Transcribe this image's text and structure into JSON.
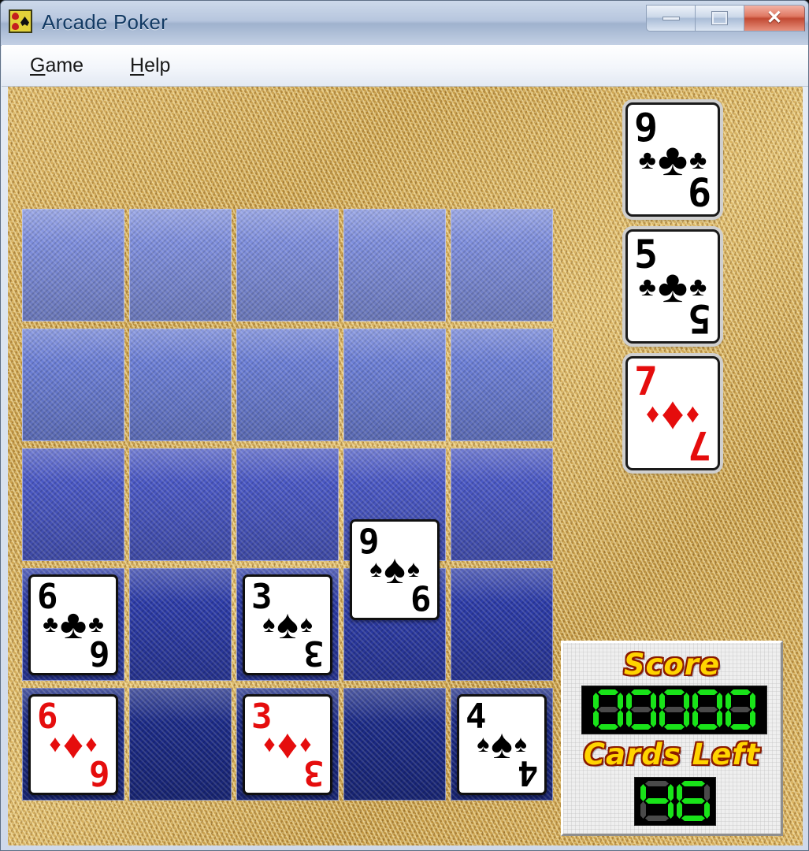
{
  "window": {
    "title": "Arcade Poker",
    "icon": "playing-cards-icon",
    "controls": {
      "minimize": "–",
      "maximize": "□",
      "close": "✕"
    }
  },
  "menubar": {
    "items": [
      {
        "label": "Game",
        "mnemonic": "G"
      },
      {
        "label": "Help",
        "mnemonic": "H"
      }
    ]
  },
  "theme": {
    "felt_color": "#c9a24e",
    "card_back_light": "#7e8edd",
    "card_back_dark": "#1b2a87",
    "lcd_on": "#19e319",
    "lcd_off": "#4a4a4a",
    "label_fill": "#ffd400",
    "label_outline": "#8a1a00",
    "red_suit": "#e50d0d",
    "black_suit": "#000000"
  },
  "scorepanel": {
    "score_label": "Score",
    "score_value": "00000",
    "score_digits": 5,
    "cards_left_label": "Cards Left",
    "cards_left_value": "46",
    "cards_left_digits": 2
  },
  "waiting_cards": [
    {
      "rank": "9",
      "suit": "clubs",
      "suit_glyph": "♣",
      "color": "black"
    },
    {
      "rank": "5",
      "suit": "clubs",
      "suit_glyph": "♣",
      "color": "black"
    },
    {
      "rank": "7",
      "suit": "diamonds",
      "suit_glyph": "♦",
      "color": "red"
    }
  ],
  "grid": {
    "rows": 5,
    "cols": 5,
    "cells": [
      {
        "row": 1,
        "col": 1,
        "state": "face-down",
        "tone": 1
      },
      {
        "row": 1,
        "col": 2,
        "state": "face-down",
        "tone": 1
      },
      {
        "row": 1,
        "col": 3,
        "state": "face-down",
        "tone": 1
      },
      {
        "row": 1,
        "col": 4,
        "state": "face-down",
        "tone": 1
      },
      {
        "row": 1,
        "col": 5,
        "state": "face-down",
        "tone": 1
      },
      {
        "row": 2,
        "col": 1,
        "state": "face-down",
        "tone": 2
      },
      {
        "row": 2,
        "col": 2,
        "state": "face-down",
        "tone": 2
      },
      {
        "row": 2,
        "col": 3,
        "state": "face-down",
        "tone": 2
      },
      {
        "row": 2,
        "col": 4,
        "state": "face-down",
        "tone": 2
      },
      {
        "row": 2,
        "col": 5,
        "state": "face-down",
        "tone": 2
      },
      {
        "row": 3,
        "col": 1,
        "state": "face-down",
        "tone": 3
      },
      {
        "row": 3,
        "col": 2,
        "state": "face-down",
        "tone": 3
      },
      {
        "row": 3,
        "col": 3,
        "state": "face-down",
        "tone": 3
      },
      {
        "row": 3,
        "col": 4,
        "state": "face-down",
        "tone": 3
      },
      {
        "row": 3,
        "col": 5,
        "state": "face-down",
        "tone": 3
      },
      {
        "row": 4,
        "col": 1,
        "state": "face-up",
        "tone": 4,
        "rank": "6",
        "suit": "clubs",
        "suit_glyph": "♣",
        "color": "black"
      },
      {
        "row": 4,
        "col": 2,
        "state": "face-down",
        "tone": 4
      },
      {
        "row": 4,
        "col": 3,
        "state": "face-up",
        "tone": 4,
        "rank": "3",
        "suit": "spades",
        "suit_glyph": "♠",
        "color": "black"
      },
      {
        "row": 4,
        "col": 4,
        "state": "face-up",
        "tone": 4,
        "rank": "9",
        "suit": "spades",
        "suit_glyph": "♠",
        "color": "black",
        "raised": true
      },
      {
        "row": 4,
        "col": 5,
        "state": "face-down",
        "tone": 4
      },
      {
        "row": 5,
        "col": 1,
        "state": "face-up",
        "tone": 5,
        "rank": "6",
        "suit": "diamonds",
        "suit_glyph": "♦",
        "color": "red"
      },
      {
        "row": 5,
        "col": 2,
        "state": "face-down",
        "tone": 5
      },
      {
        "row": 5,
        "col": 3,
        "state": "face-up",
        "tone": 5,
        "rank": "3",
        "suit": "diamonds",
        "suit_glyph": "♦",
        "color": "red"
      },
      {
        "row": 5,
        "col": 4,
        "state": "face-down",
        "tone": 5
      },
      {
        "row": 5,
        "col": 5,
        "state": "face-up",
        "tone": 5,
        "rank": "4",
        "suit": "spades",
        "suit_glyph": "♠",
        "color": "black"
      }
    ]
  }
}
